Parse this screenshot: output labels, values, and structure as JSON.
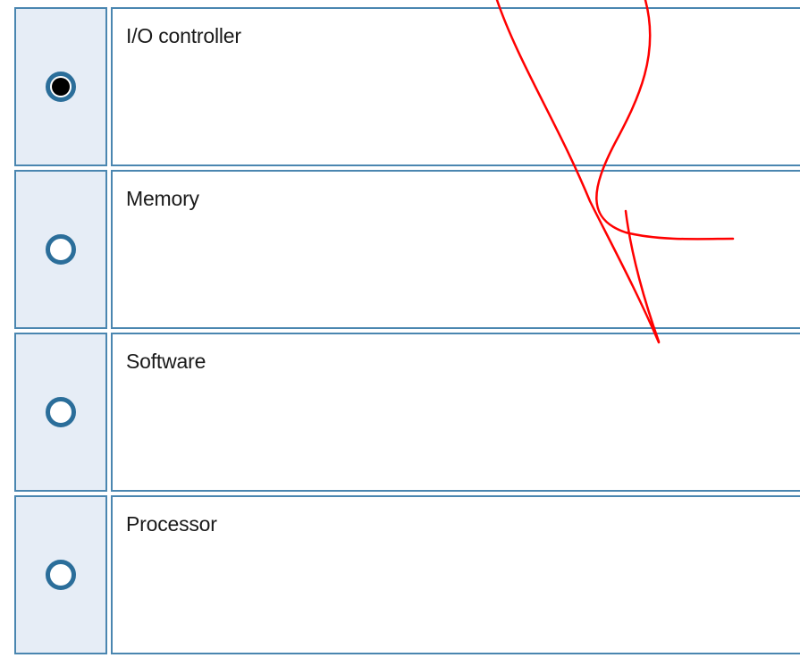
{
  "question": {
    "options": [
      {
        "label": "I/O controller",
        "selected": true
      },
      {
        "label": "Memory",
        "selected": false
      },
      {
        "label": "Software",
        "selected": false
      },
      {
        "label": "Processor",
        "selected": false
      }
    ]
  },
  "colors": {
    "cell_border": "#4a86b0",
    "radio_cell_bg": "#e6edf6",
    "radio_ring": "#2b6e9a",
    "annotation_stroke": "#ff0000"
  }
}
